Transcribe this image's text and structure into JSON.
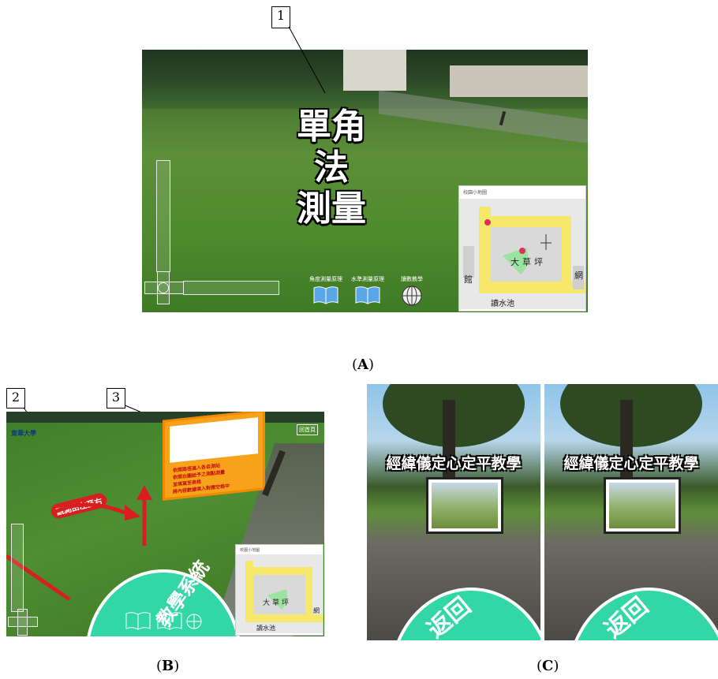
{
  "figure": {
    "captions": {
      "a": "A",
      "b": "B",
      "c": "C"
    },
    "callouts": [
      "1",
      "2",
      "3"
    ]
  },
  "panel_a": {
    "title_line1": "單角法",
    "title_line2": "測量",
    "toolbar": [
      {
        "caption": "角度測量原理",
        "icon": "book-icon"
      },
      {
        "caption": "水準測量原理",
        "icon": "book-icon"
      },
      {
        "caption": "讀數教學",
        "icon": "globe-icon"
      }
    ],
    "minimap": {
      "header": "校園小地圖",
      "field_label": [
        "大",
        "草",
        "坪"
      ],
      "left_label": "館",
      "right_label": "網",
      "bottom_label": "讀水池"
    }
  },
  "panel_b": {
    "logo_text": "東華大學",
    "red_tag": "觀測由左至右",
    "board_text": [
      "依照路徑進入各自測站",
      "依照右圖給予之測點測量",
      "並填寫至表格",
      "將內容數據填入對應空格中"
    ],
    "top_right_button": "回首頁",
    "minimap": {
      "header": "校園小地圖",
      "field_label": [
        "大",
        "草",
        "坪"
      ],
      "right_label": "網",
      "bottom_label": "讀水池"
    },
    "dome_text": "教學系統"
  },
  "panel_c": {
    "vr_title": "經緯儀定心定平教學",
    "dome_text": "返回"
  },
  "colors": {
    "accent_green": "#32d7a5",
    "board_orange": "#f7a21a",
    "tag_red": "#d81e1e",
    "map_yellow": "#f6e86a",
    "map_field": "#9be3a0"
  }
}
